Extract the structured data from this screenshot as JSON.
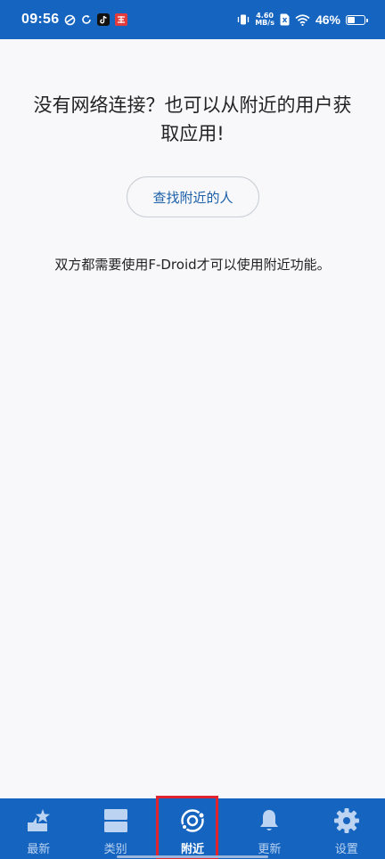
{
  "status_bar": {
    "time": "09:56",
    "net_speed_value": "4.60",
    "net_speed_unit": "MB/s",
    "battery_percent": "46%"
  },
  "main": {
    "title": "没有网络连接？也可以从附近的用户获取应用!",
    "find_button_label": "查找附近的人",
    "description": "双方都需要使用F-Droid才可以使用附近功能。"
  },
  "bottom_nav": {
    "items": [
      {
        "label": "最新",
        "icon": "latest-star-icon",
        "active": false
      },
      {
        "label": "类别",
        "icon": "categories-icon",
        "active": false
      },
      {
        "label": "附近",
        "icon": "nearby-icon",
        "active": true
      },
      {
        "label": "更新",
        "icon": "bell-icon",
        "active": false
      },
      {
        "label": "设置",
        "icon": "gear-icon",
        "active": false
      }
    ]
  },
  "colors": {
    "primary": "#1565c0",
    "button_text": "#1a5fa8",
    "highlight": "#e0232e"
  }
}
